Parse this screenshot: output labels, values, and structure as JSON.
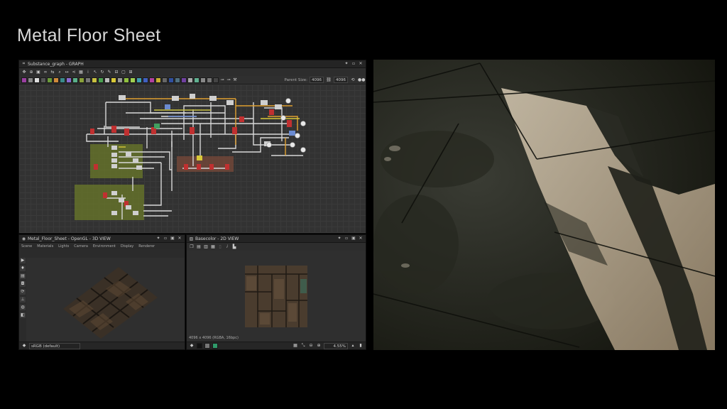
{
  "page": {
    "title": "Metal Floor Sheet"
  },
  "graph_panel": {
    "title": "Substance_graph - GRAPH",
    "parent_size_label": "Parent Size:",
    "parent_size_value": "4096",
    "size_value": "4096"
  },
  "view3d_panel": {
    "title": "Metal_Floor_Sheet - OpenGL - 3D VIEW",
    "menu": [
      "Scene",
      "Materials",
      "Lights",
      "Camera",
      "Environment",
      "Display",
      "Renderer"
    ],
    "colorspace": "sRGB (default)"
  },
  "view2d_panel": {
    "title": "Basecolor - 2D VIEW",
    "resolution_info": "4096 x 4096 (RGBA, 16bpc)",
    "zoom": "4.55%"
  },
  "colors": {
    "background": "#000000",
    "panel": "#2b2b2b",
    "graph_frame_green": "#6b7a2a",
    "graph_frame_brown": "#7a4a3a"
  }
}
